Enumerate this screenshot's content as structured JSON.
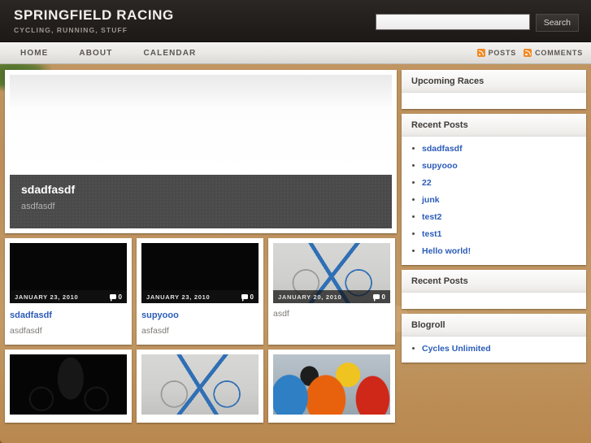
{
  "header": {
    "site_title": "SPRINGFIELD RACING",
    "tagline": "CYCLING, RUNNING, STUFF",
    "search": {
      "value": "",
      "placeholder": "",
      "button_label": "Search"
    }
  },
  "nav": {
    "items": [
      {
        "label": "HOME"
      },
      {
        "label": "ABOUT"
      },
      {
        "label": "CALENDAR"
      }
    ],
    "feeds": [
      {
        "label": "POSTS",
        "icon": "rss-icon"
      },
      {
        "label": "COMMENTS",
        "icon": "rss-icon"
      }
    ]
  },
  "featured": {
    "title": "sdadfasdf",
    "excerpt": "asdfasdf"
  },
  "posts": [
    {
      "title": "sdadfasdf",
      "excerpt": "asdfasdf",
      "date": "JANUARY 23, 2010",
      "comments": "0",
      "thumb": "black"
    },
    {
      "title": "supyooo",
      "excerpt": "asfasdf",
      "date": "JANUARY 23, 2010",
      "comments": "0",
      "thumb": "black"
    },
    {
      "title": "",
      "excerpt": "asdf",
      "date": "JANUARY 20, 2010",
      "comments": "0",
      "thumb": "bike"
    },
    {
      "title": "",
      "excerpt": "",
      "date": "",
      "comments": "",
      "thumb": "silhouette"
    },
    {
      "title": "",
      "excerpt": "",
      "date": "",
      "comments": "",
      "thumb": "bike"
    },
    {
      "title": "",
      "excerpt": "",
      "date": "",
      "comments": "",
      "thumb": "peloton"
    }
  ],
  "sidebar": {
    "widgets": [
      {
        "title": "Upcoming Races",
        "links": []
      },
      {
        "title": "Recent Posts",
        "links": [
          {
            "label": "sdadfasdf"
          },
          {
            "label": "supyooo"
          },
          {
            "label": "22"
          },
          {
            "label": "junk"
          },
          {
            "label": "test2"
          },
          {
            "label": "test1"
          },
          {
            "label": "Hello world!"
          }
        ]
      },
      {
        "title": "Recent Posts",
        "links": []
      },
      {
        "title": "Blogroll",
        "links": [
          {
            "label": "Cycles Unlimited"
          }
        ]
      }
    ]
  },
  "colors": {
    "link": "#2b5cb8",
    "rss": "#f08a24",
    "header_bg": "#231f1c",
    "page_bg": "#bb8e5a"
  }
}
